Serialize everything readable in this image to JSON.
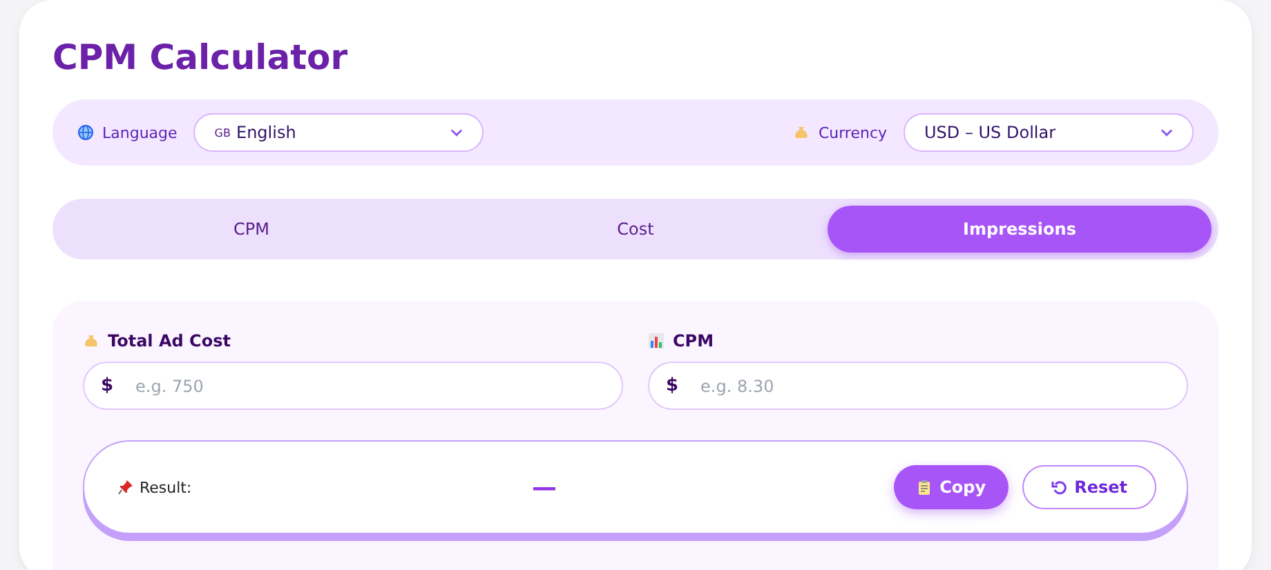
{
  "title": "CPM Calculator",
  "settings": {
    "language": {
      "label": "Language",
      "flag": "GB",
      "value": "English"
    },
    "currency": {
      "label": "Currency",
      "value": "USD – US Dollar"
    }
  },
  "tabs": [
    {
      "label": "CPM",
      "selected": false
    },
    {
      "label": "Cost",
      "selected": false
    },
    {
      "label": "Impressions",
      "selected": true
    }
  ],
  "fields": [
    {
      "kind": "money",
      "label": "Total Ad Cost",
      "prefix": "$",
      "placeholder": "e.g. 750"
    },
    {
      "kind": "chart",
      "label": "CPM",
      "prefix": "$",
      "placeholder": "e.g. 8.30"
    }
  ],
  "result": {
    "label": "Result:",
    "value": "—",
    "buttons": [
      {
        "kind": "copy",
        "label": "Copy"
      },
      {
        "kind": "reset",
        "label": "Reset"
      }
    ]
  }
}
